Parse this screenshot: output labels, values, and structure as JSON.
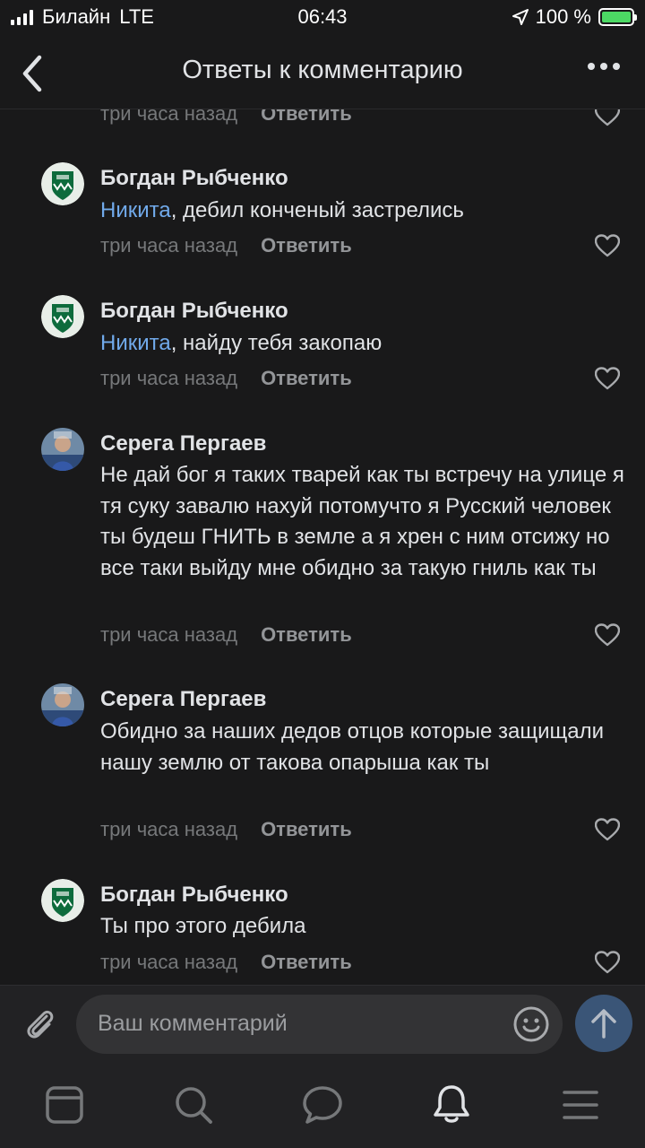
{
  "status_bar": {
    "carrier": "Билайн",
    "network": "LTE",
    "time": "06:43",
    "battery": "100 %"
  },
  "nav": {
    "title": "Ответы к комментарию"
  },
  "comments": [
    {
      "author": "",
      "mention": "",
      "text": "",
      "time": "три часа назад",
      "reply_label": "Ответить",
      "avatar": "none"
    },
    {
      "author": "Богдан Рыбченко",
      "mention": "Никита",
      "text": ", дебил конченый застрелись",
      "time": "три часа назад",
      "reply_label": "Ответить",
      "avatar": "football-club-logo"
    },
    {
      "author": "Богдан Рыбченко",
      "mention": "Никита",
      "text": ", найду тебя закопаю",
      "time": "три часа назад",
      "reply_label": "Ответить",
      "avatar": "football-club-logo"
    },
    {
      "author": "Серега Пергаев",
      "mention": "",
      "text": "Не дай бог я таких тварей как ты встречу на улице я тя суку завалю нахуй потомучто я Русский человек ты будеш ГНИТЬ в земле а я хрен с ним отсижу но все таки выйду мне обидно за такую гниль как ты",
      "time": "три часа назад",
      "reply_label": "Ответить",
      "avatar": "user-photo"
    },
    {
      "author": "Серега Пергаев",
      "mention": "",
      "text": "Обидно за наших дедов отцов которые защищали нашу землю от такова опарыша как ты",
      "time": "три часа назад",
      "reply_label": "Ответить",
      "avatar": "user-photo"
    },
    {
      "author": "Богдан Рыбченко",
      "mention": "",
      "text": "Ты про этого дебила",
      "time": "три часа назад",
      "reply_label": "Ответить",
      "avatar": "football-club-logo"
    }
  ],
  "input": {
    "placeholder": "Ваш комментарий"
  },
  "tabs": [
    "news-icon",
    "search-icon",
    "messages-icon",
    "notifications-icon",
    "menu-icon"
  ],
  "colors": {
    "background": "#19191a",
    "text": "#e1e3e6",
    "mention": "#71aaeb",
    "secondary": "#76787a",
    "accent_send": "#3a5577",
    "battery": "#4cd964"
  }
}
